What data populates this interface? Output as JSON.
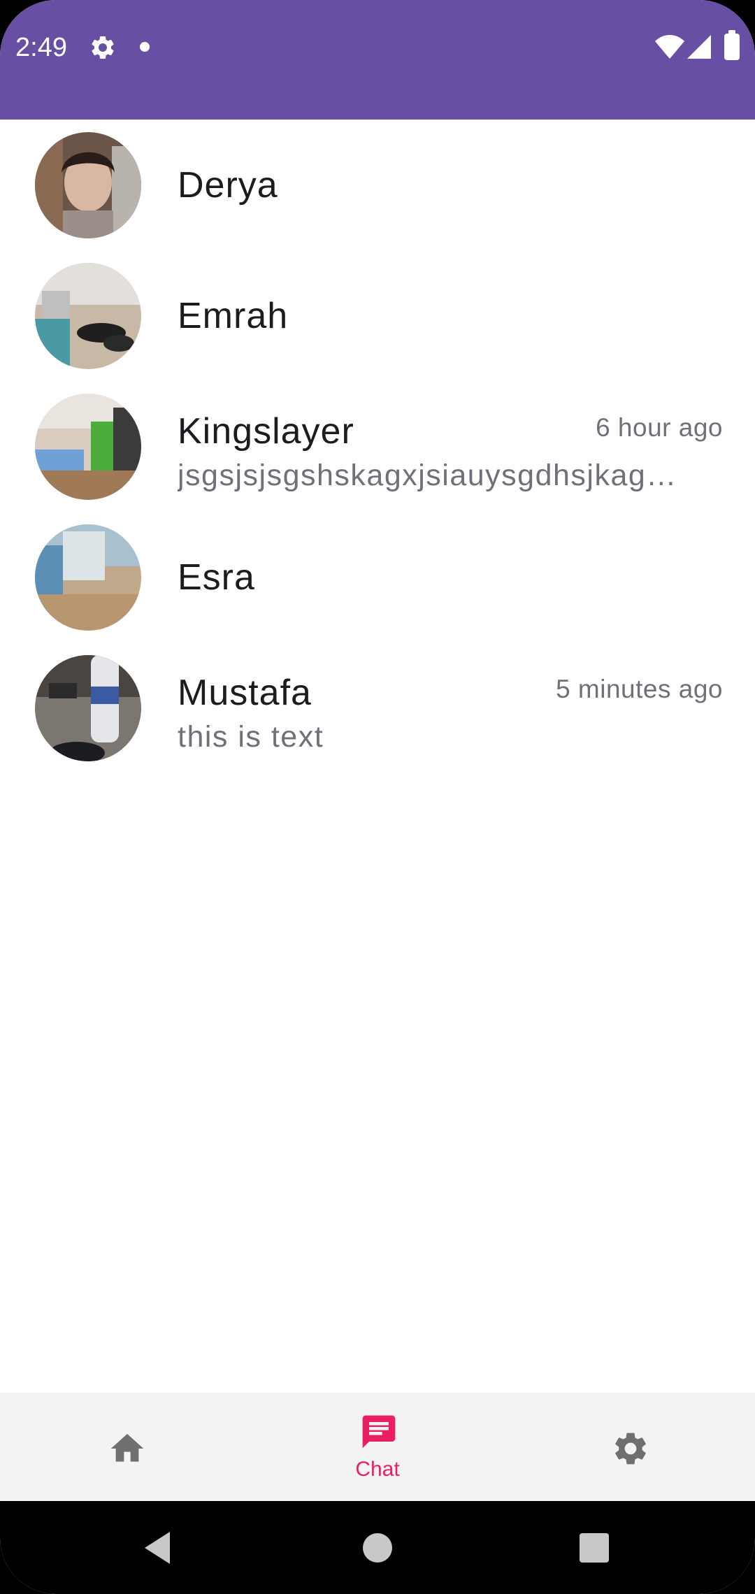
{
  "status_bar": {
    "time": "2:49",
    "background_color": "#6750a4",
    "icons": [
      "gear-icon",
      "notification-dot-icon",
      "wifi-icon",
      "signal-icon",
      "battery-icon"
    ]
  },
  "chats": [
    {
      "name": "Derya",
      "time": "",
      "preview": ""
    },
    {
      "name": "Emrah",
      "time": "",
      "preview": ""
    },
    {
      "name": "Kingslayer",
      "time": "6 hour ago",
      "preview": "jsgsjsjsgshskagxjsiauysgdhsjkagsjs"
    },
    {
      "name": "Esra",
      "time": "",
      "preview": ""
    },
    {
      "name": "Mustafa",
      "time": "5 minutes ago",
      "preview": "this is text"
    }
  ],
  "bottom_nav": {
    "items": [
      {
        "icon": "home-icon",
        "label": "",
        "selected": false
      },
      {
        "icon": "chat-icon",
        "label": "Chat",
        "selected": true
      },
      {
        "icon": "settings-icon",
        "label": "",
        "selected": false
      }
    ],
    "selected_color": "#e91e63",
    "unselected_color": "#6f6f6f"
  },
  "system_nav": {
    "icons": [
      "back-icon",
      "home-circle-icon",
      "recents-icon"
    ]
  }
}
